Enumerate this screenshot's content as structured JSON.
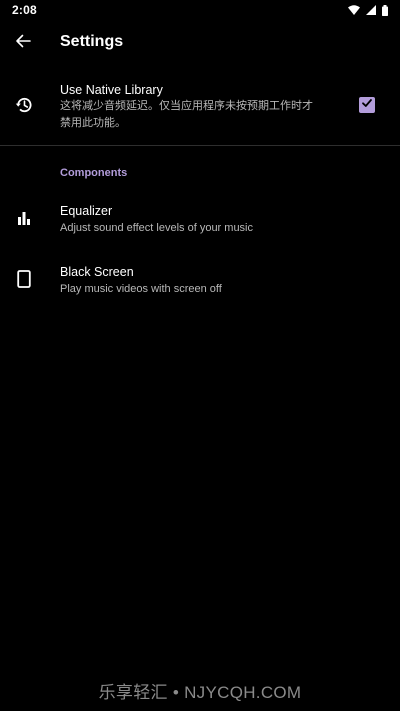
{
  "status_bar": {
    "time": "2:08",
    "icons": [
      "wifi-icon",
      "signal-icon",
      "battery-icon"
    ]
  },
  "toolbar": {
    "title": "Settings",
    "back_icon": "arrow-back-icon"
  },
  "preferences": [
    {
      "icon": "history-icon",
      "title": "Use Native Library",
      "summary_line1": "这将减少音频延迟。仅当应用程序未按预期工作时才",
      "summary_line2": "禁用此功能。",
      "checked": true
    }
  ],
  "category": {
    "title": "Components",
    "items": [
      {
        "icon": "equalizer-icon",
        "title": "Equalizer",
        "summary": "Adjust sound effect levels of your music"
      },
      {
        "icon": "phone-screen-icon",
        "title": "Black Screen",
        "summary": "Play music videos with screen off"
      }
    ]
  },
  "watermark": "乐享轻汇 • NJYCQH.COM",
  "colors": {
    "background": "#000000",
    "accent": "#b39ddb",
    "text_primary": "#ffffff",
    "text_secondary": "#b8b8b8",
    "divider": "#2e2e2e"
  }
}
